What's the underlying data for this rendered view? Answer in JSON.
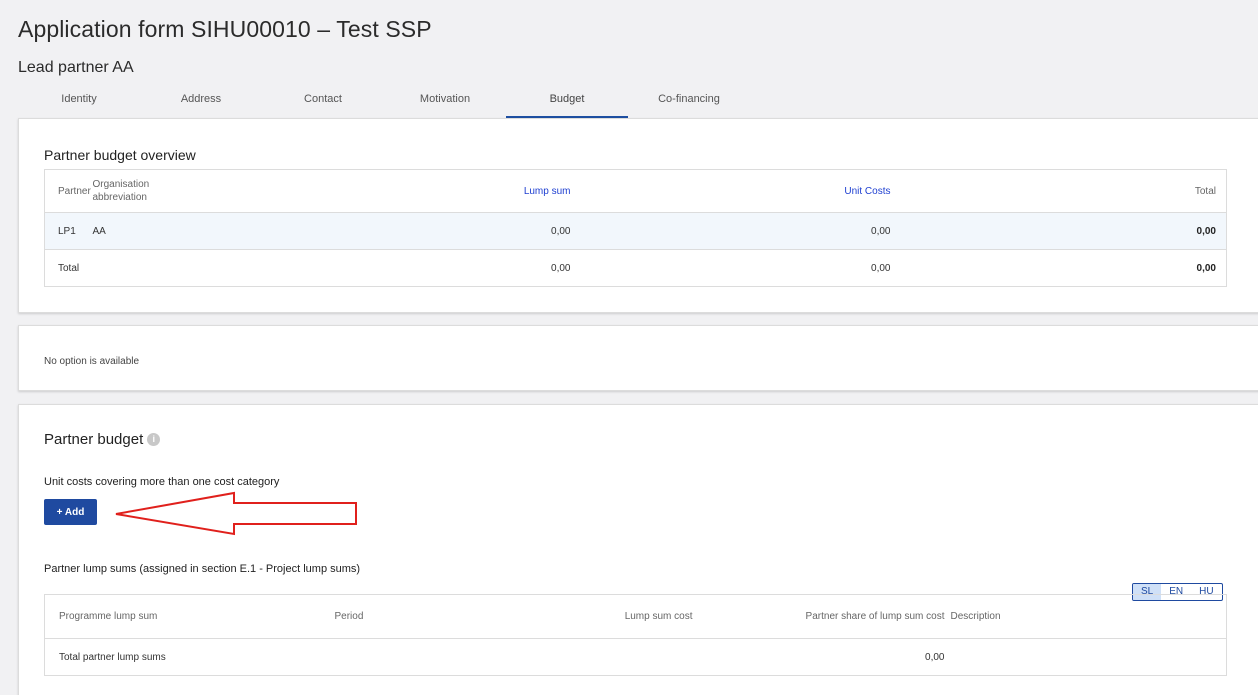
{
  "header": {
    "title": "Application form SIHU00010 – Test SSP",
    "subtitle": "Lead partner AA"
  },
  "tabs": [
    {
      "label": "Identity"
    },
    {
      "label": "Address"
    },
    {
      "label": "Contact"
    },
    {
      "label": "Motivation"
    },
    {
      "label": "Budget",
      "active": true
    },
    {
      "label": "Co-financing"
    }
  ],
  "overview": {
    "title": "Partner budget overview",
    "columns": {
      "partner": "Partner",
      "org": "Organisation abbreviation",
      "lump": "Lump sum",
      "unit": "Unit Costs",
      "total": "Total"
    },
    "rows": [
      {
        "partner": "LP1",
        "org": "AA",
        "lump": "0,00",
        "unit": "0,00",
        "total": "0,00"
      }
    ],
    "total_row": {
      "label": "Total",
      "lump": "0,00",
      "unit": "0,00",
      "total": "0,00"
    }
  },
  "options": {
    "empty_text": "No option is available"
  },
  "partner_budget": {
    "title": "Partner budget",
    "info_icon": "info-icon",
    "unit_costs_label": "Unit costs covering more than one cost category",
    "add_button": "+ Add",
    "lump_sums_label": "Partner lump sums (assigned in section E.1 - Project lump sums)",
    "languages": [
      "SL",
      "EN",
      "HU"
    ],
    "active_language": "SL",
    "lump_table": {
      "columns": {
        "programme": "Programme lump sum",
        "period": "Period",
        "cost": "Lump sum cost",
        "share": "Partner share of lump sum cost",
        "description": "Description"
      },
      "total_label": "Total partner lump sums",
      "total_share": "0,00"
    }
  },
  "annotation": {
    "arrow_color": "#e0201c"
  }
}
